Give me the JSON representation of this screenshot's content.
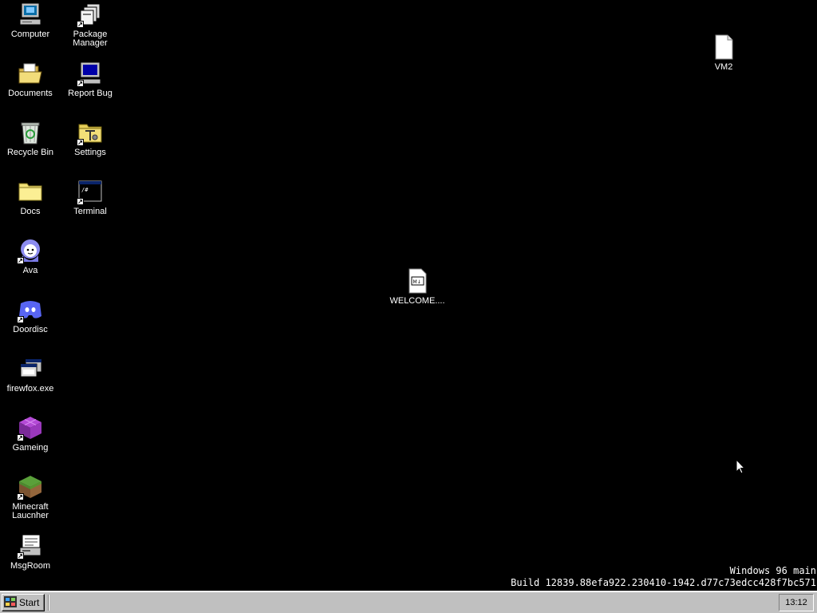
{
  "desktop": {
    "icons": {
      "computer": "Computer",
      "package_manager": "Package Manager",
      "documents": "Documents",
      "report_bug": "Report Bug",
      "recycle_bin": "Recycle Bin",
      "settings": "Settings",
      "docs": "Docs",
      "terminal": "Terminal",
      "ava": "Ava",
      "doordisc": "Doordisc",
      "firewfox": "firewfox.exe",
      "gameing": "Gameing",
      "minecraft": "Minecraft Laucnher",
      "msgroom": "MsgRoom",
      "welcome": "WELCOME....",
      "vm2": "VM2"
    },
    "watermark": {
      "line1": "Windows 96 main",
      "line2": "Build 12839.88efa922.230410-1942.d77c73edcc428f7bc571"
    }
  },
  "taskbar": {
    "start_label": "Start",
    "clock": "13:12"
  },
  "colors": {
    "desktop_bg": "#000000",
    "taskbar_bg": "#c0c0c0"
  }
}
